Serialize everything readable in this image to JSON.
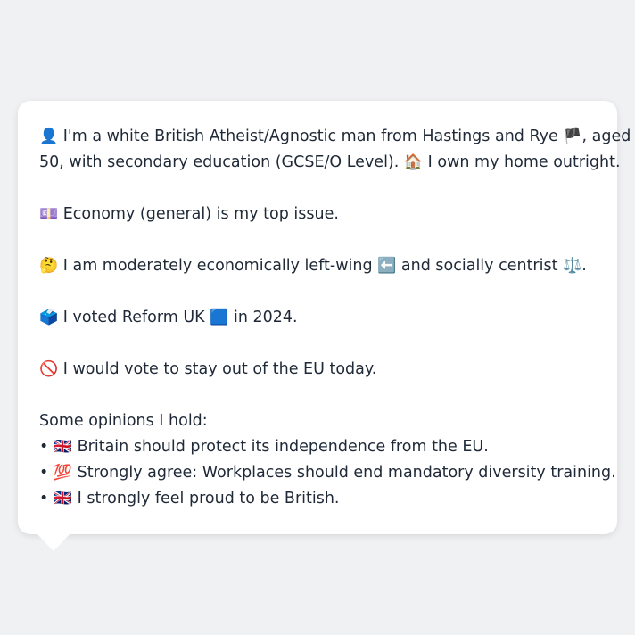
{
  "profile": {
    "identity_emoji": "👤",
    "identity_text_a": "I'm a white British Atheist/Agnostic man from Hastings and Rye",
    "flag_emoji": "🏴",
    "identity_text_b": ", aged",
    "identity_text_c": "50, with secondary education (GCSE/O Level).",
    "home_emoji": "🏠",
    "home_text": "I own my home outright."
  },
  "issue": {
    "emoji": "💷",
    "text": "Economy (general) is my top issue."
  },
  "ideology": {
    "emoji": "🤔",
    "text_a": "I am moderately economically left-wing",
    "left_emoji": "⬅️",
    "text_b": "and socially centrist",
    "scale_emoji": "⚖️",
    "text_c": "."
  },
  "vote": {
    "emoji": "🗳️",
    "text_a": "I voted Reform UK",
    "party_emoji": "🟦",
    "text_b": "in 2024."
  },
  "eu": {
    "emoji": "🚫",
    "text": "I would vote to stay out of the EU today."
  },
  "opinions": {
    "heading": "Some opinions I hold:",
    "items": [
      {
        "bullet": "•",
        "emoji": "🇬🇧",
        "text": "Britain should protect its independence from the EU."
      },
      {
        "bullet": "•",
        "emoji": "💯",
        "text": "Strongly agree: Workplaces should end mandatory diversity training."
      },
      {
        "bullet": "•",
        "emoji": "🇬🇧",
        "text": "I strongly feel proud to be British."
      }
    ]
  }
}
